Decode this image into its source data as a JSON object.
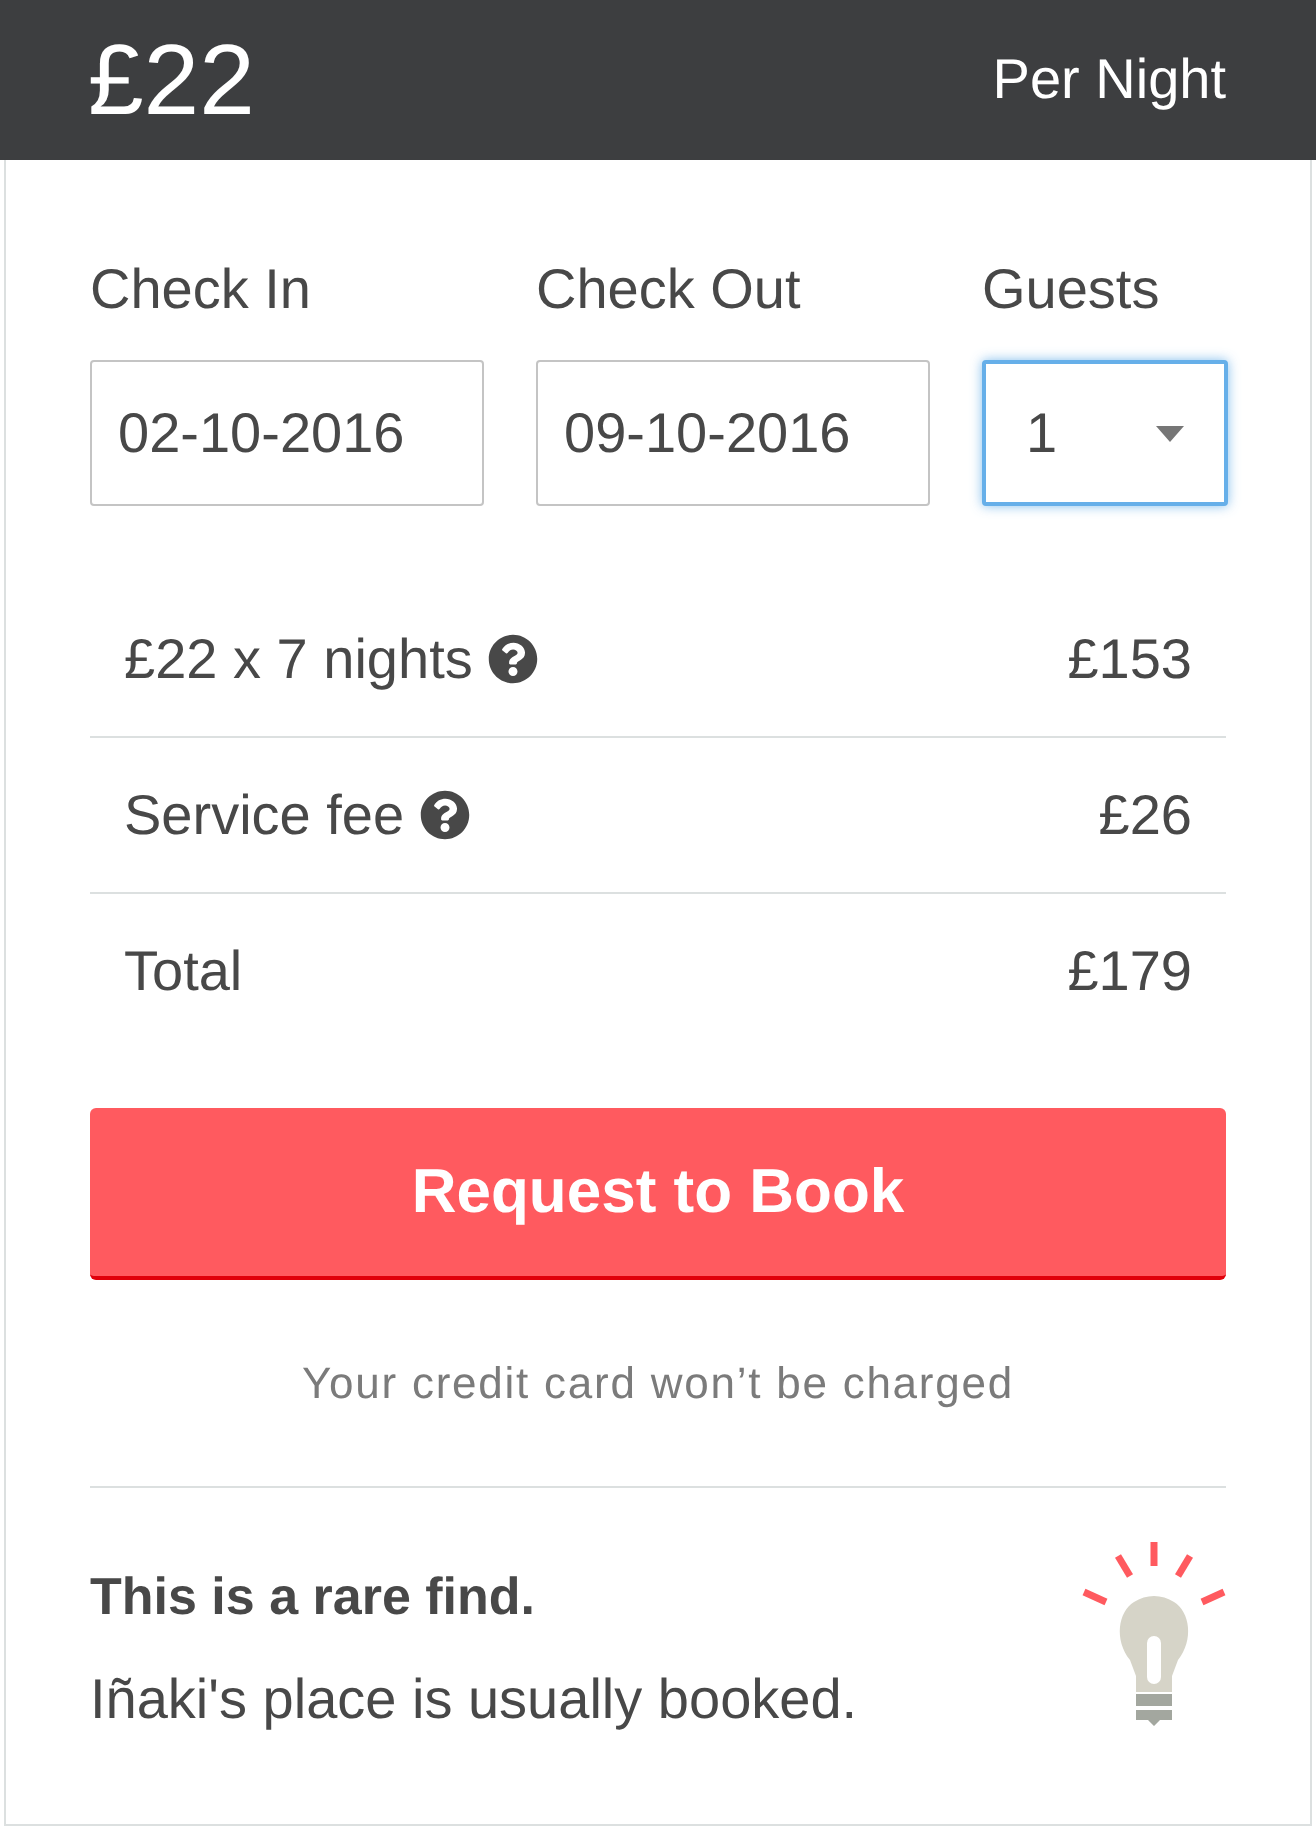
{
  "header": {
    "price": "£22",
    "unit": "Per Night"
  },
  "fields": [
    {
      "kind": "date",
      "label": "Check In",
      "value": "02-10-2016",
      "focused": false
    },
    {
      "kind": "date",
      "label": "Check Out",
      "value": "09-10-2016",
      "focused": false
    },
    {
      "kind": "select",
      "label": "Guests",
      "value": "1",
      "focused": true
    }
  ],
  "price_rows": [
    {
      "label": "£22 x 7 nights",
      "help": true,
      "amount": "£153"
    },
    {
      "label": "Service fee",
      "help": true,
      "amount": "£26"
    },
    {
      "label": "Total",
      "help": false,
      "amount": "£179"
    }
  ],
  "book_button": "Request to Book",
  "note": "Your credit card won’t be charged",
  "notice": {
    "title": "This is a rare find.",
    "text": "Iñaki's place is usually booked."
  }
}
